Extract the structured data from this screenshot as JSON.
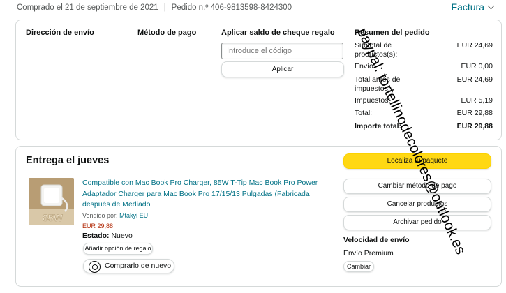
{
  "header": {
    "purchased": "Comprado el 21 de septiembre de 2021",
    "order_label": "Pedido n.º 406-9813598-8424300",
    "invoice": "Factura"
  },
  "summary": {
    "shipping_title": "Dirección de envío",
    "payment_title": "Método de pago",
    "gift_title": "Aplicar saldo de cheque regalo",
    "gift_placeholder": "Introduce el código",
    "apply_label": "Aplicar",
    "order_summary_title": "Resumen del pedido",
    "rows": [
      {
        "label": "Subtotal de productos(s):",
        "value": "EUR 24,69"
      },
      {
        "label": "Envío:",
        "value": "EUR 0,00"
      },
      {
        "label": "Total antes de impuestos:",
        "value": "EUR 24,69"
      },
      {
        "label": "Impuestos:",
        "value": "EUR 5,19"
      },
      {
        "label": "Total:",
        "value": "EUR 29,88"
      },
      {
        "label": "Importe total:",
        "value": "EUR 29,88"
      }
    ]
  },
  "delivery": {
    "title": "Entrega el jueves",
    "product_title": "Compatible con Mac Book Pro Charger, 85W T-Tip Mac Book Pro Power Adaptador Charger para Mac Book Pro 17/15/13 Pulgadas (Fabricada después de Mediado",
    "thumb_text": "85W",
    "seller_label": "Vendido por:",
    "seller_name": "Mtakyi EU",
    "price": "EUR 29,88",
    "status_label": "Estado:",
    "status_value": "Nuevo",
    "gift_option": "Añadir opción de regalo",
    "rebuy": "Comprarlo de nuevo",
    "track": "Localiza tu paquete",
    "change_payment": "Cambiar método de pago",
    "cancel": "Cancelar productos",
    "archive": "Archivar pedido",
    "speed_title": "Velocidad de envío",
    "speed_value": "Envío Premium",
    "change": "Cambiar"
  },
  "watermark": "paypal: tortellinodecolores@outlook.es",
  "colors": {
    "link": "#007185",
    "price": "#b12704",
    "primary_button": "#ffd814"
  }
}
